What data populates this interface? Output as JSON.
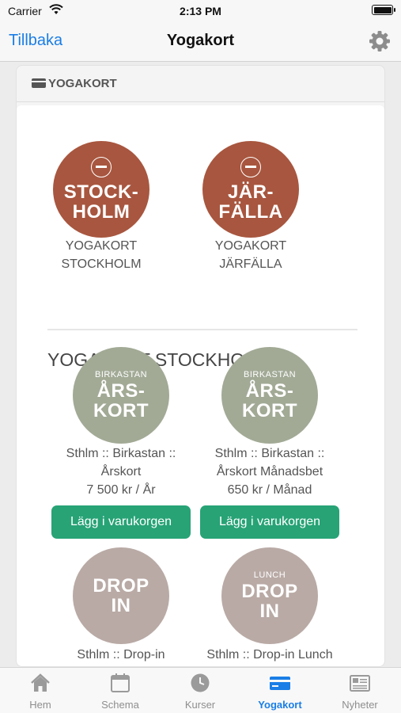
{
  "status_bar": {
    "carrier": "Carrier",
    "time": "2:13 PM"
  },
  "nav": {
    "back": "Tillbaka",
    "title": "Yogakort"
  },
  "panel": {
    "header": "YOGAKORT"
  },
  "locations": [
    {
      "circle_lines": [
        "STOCK-",
        "HOLM"
      ],
      "caption_lines": [
        "YOGAKORT",
        "STOCKHOLM"
      ]
    },
    {
      "circle_lines": [
        "JÄR-",
        "FÄLLA"
      ],
      "caption_lines": [
        "YOGAKORT",
        "JÄRFÄLLA"
      ]
    }
  ],
  "section_title": "YOGAKORT STOCKHOLM",
  "products": [
    {
      "circle_small": "BIRKASTAN",
      "circle_lines": [
        "ÅRS-",
        "KORT"
      ],
      "name_lines": [
        "Sthlm :: Birkastan ::",
        "Årskort"
      ],
      "price": "7 500 kr / År",
      "button": "Lägg i varukorgen"
    },
    {
      "circle_small": "BIRKASTAN",
      "circle_lines": [
        "ÅRS-",
        "KORT"
      ],
      "name_lines": [
        "Sthlm :: Birkastan ::",
        "Årskort Månadsbet"
      ],
      "price": "650 kr / Månad",
      "button": "Lägg i varukorgen"
    },
    {
      "circle_small": "",
      "circle_lines": [
        "DROP",
        "IN"
      ],
      "name_lines": [
        "Sthlm :: Drop-in"
      ]
    },
    {
      "circle_small": "LUNCH",
      "circle_lines": [
        "DROP",
        "IN"
      ],
      "name_lines": [
        "Sthlm :: Drop-in Lunch"
      ]
    }
  ],
  "tabs": [
    {
      "label": "Hem",
      "icon": "home-icon"
    },
    {
      "label": "Schema",
      "icon": "calendar-icon"
    },
    {
      "label": "Kurser",
      "icon": "clock-icon"
    },
    {
      "label": "Yogakort",
      "icon": "card-icon",
      "active": true
    },
    {
      "label": "Nyheter",
      "icon": "newspaper-icon"
    }
  ],
  "colors": {
    "accent": "#1a7ee6",
    "button": "#27a376",
    "rust": "#a8563f",
    "sage": "#a2aa96",
    "mauve": "#b9aaa5"
  }
}
